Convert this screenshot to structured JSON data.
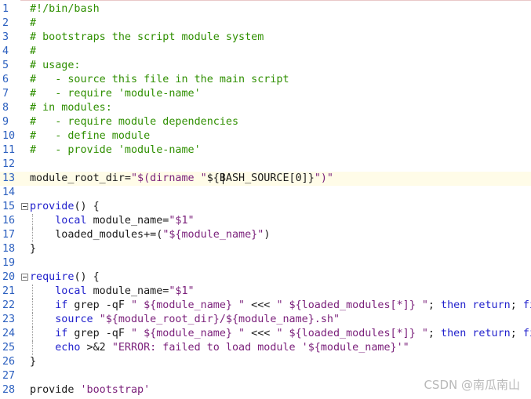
{
  "lines": [
    {
      "n": "1",
      "parts": [
        [
          "cmt",
          "#!/bin/bash"
        ]
      ]
    },
    {
      "n": "2",
      "parts": [
        [
          "cmt",
          "#"
        ]
      ]
    },
    {
      "n": "3",
      "parts": [
        [
          "cmt",
          "# bootstraps the script module system"
        ]
      ]
    },
    {
      "n": "4",
      "parts": [
        [
          "cmt",
          "#"
        ]
      ]
    },
    {
      "n": "5",
      "parts": [
        [
          "cmt",
          "# usage:"
        ]
      ]
    },
    {
      "n": "6",
      "parts": [
        [
          "cmt",
          "#   - source this file in the main script"
        ]
      ]
    },
    {
      "n": "7",
      "parts": [
        [
          "cmt",
          "#   - require 'module-name'"
        ]
      ]
    },
    {
      "n": "8",
      "parts": [
        [
          "cmt",
          "# in modules:"
        ]
      ]
    },
    {
      "n": "9",
      "parts": [
        [
          "cmt",
          "#   - require module dependencies"
        ]
      ]
    },
    {
      "n": "10",
      "parts": [
        [
          "cmt",
          "#   - define module"
        ]
      ]
    },
    {
      "n": "11",
      "parts": [
        [
          "cmt",
          "#   - provide 'module-name'"
        ]
      ]
    },
    {
      "n": "12",
      "parts": []
    },
    {
      "n": "13",
      "current": true,
      "parts": [
        [
          "op",
          "module_root_dir="
        ],
        [
          "str",
          "\"$(dirname \""
        ],
        [
          "op",
          "${BASH_SOURCE[0]}"
        ],
        [
          "str",
          "\")\""
        ]
      ]
    },
    {
      "n": "14",
      "parts": []
    },
    {
      "n": "15",
      "fold": true,
      "parts": [
        [
          "kw",
          "provide"
        ],
        [
          "op",
          "() {"
        ]
      ]
    },
    {
      "n": "16",
      "guide": true,
      "parts": [
        [
          "op",
          "    "
        ],
        [
          "kw",
          "local"
        ],
        [
          "op",
          " module_name="
        ],
        [
          "str",
          "\"$1\""
        ]
      ]
    },
    {
      "n": "17",
      "guide": true,
      "parts": [
        [
          "op",
          "    loaded_modules+=("
        ],
        [
          "str",
          "\"${module_name}\""
        ],
        [
          "op",
          ")"
        ]
      ]
    },
    {
      "n": "18",
      "parts": [
        [
          "op",
          "}"
        ]
      ]
    },
    {
      "n": "19",
      "parts": []
    },
    {
      "n": "20",
      "fold": true,
      "parts": [
        [
          "kw",
          "require"
        ],
        [
          "op",
          "() {"
        ]
      ]
    },
    {
      "n": "21",
      "guide": true,
      "parts": [
        [
          "op",
          "    "
        ],
        [
          "kw",
          "local"
        ],
        [
          "op",
          " module_name="
        ],
        [
          "str",
          "\"$1\""
        ]
      ]
    },
    {
      "n": "22",
      "guide": true,
      "parts": [
        [
          "op",
          "    "
        ],
        [
          "kw",
          "if"
        ],
        [
          "op",
          " grep -qF "
        ],
        [
          "str",
          "\" ${module_name} \""
        ],
        [
          "op",
          " <<< "
        ],
        [
          "str",
          "\" ${loaded_modules[*]} \""
        ],
        [
          "op",
          "; "
        ],
        [
          "kw",
          "then"
        ],
        [
          "op",
          " "
        ],
        [
          "kw",
          "return"
        ],
        [
          "op",
          "; "
        ],
        [
          "kw",
          "fi"
        ]
      ]
    },
    {
      "n": "23",
      "guide": true,
      "parts": [
        [
          "op",
          "    "
        ],
        [
          "kw",
          "source"
        ],
        [
          "op",
          " "
        ],
        [
          "str",
          "\"${module_root_dir}/${module_name}.sh\""
        ]
      ]
    },
    {
      "n": "24",
      "guide": true,
      "parts": [
        [
          "op",
          "    "
        ],
        [
          "kw",
          "if"
        ],
        [
          "op",
          " grep -qF "
        ],
        [
          "str",
          "\" ${module_name} \""
        ],
        [
          "op",
          " <<< "
        ],
        [
          "str",
          "\" ${loaded_modules[*]} \""
        ],
        [
          "op",
          "; "
        ],
        [
          "kw",
          "then"
        ],
        [
          "op",
          " "
        ],
        [
          "kw",
          "return"
        ],
        [
          "op",
          "; "
        ],
        [
          "kw",
          "fi"
        ]
      ]
    },
    {
      "n": "25",
      "guide": true,
      "parts": [
        [
          "op",
          "    "
        ],
        [
          "kw",
          "echo"
        ],
        [
          "op",
          " >&2 "
        ],
        [
          "str",
          "\"ERROR: failed to load module '${module_name}'\""
        ]
      ]
    },
    {
      "n": "26",
      "parts": [
        [
          "op",
          "}"
        ]
      ]
    },
    {
      "n": "27",
      "parts": []
    },
    {
      "n": "28",
      "parts": [
        [
          "op",
          "provide "
        ],
        [
          "str",
          "'bootstrap'"
        ]
      ]
    }
  ],
  "watermark": "CSDN @南瓜南山",
  "colors": {
    "comment": "#2f8f00",
    "string": "#7a1f7a",
    "keyword": "#1f1fcc",
    "line_number": "#2b5fbf"
  }
}
